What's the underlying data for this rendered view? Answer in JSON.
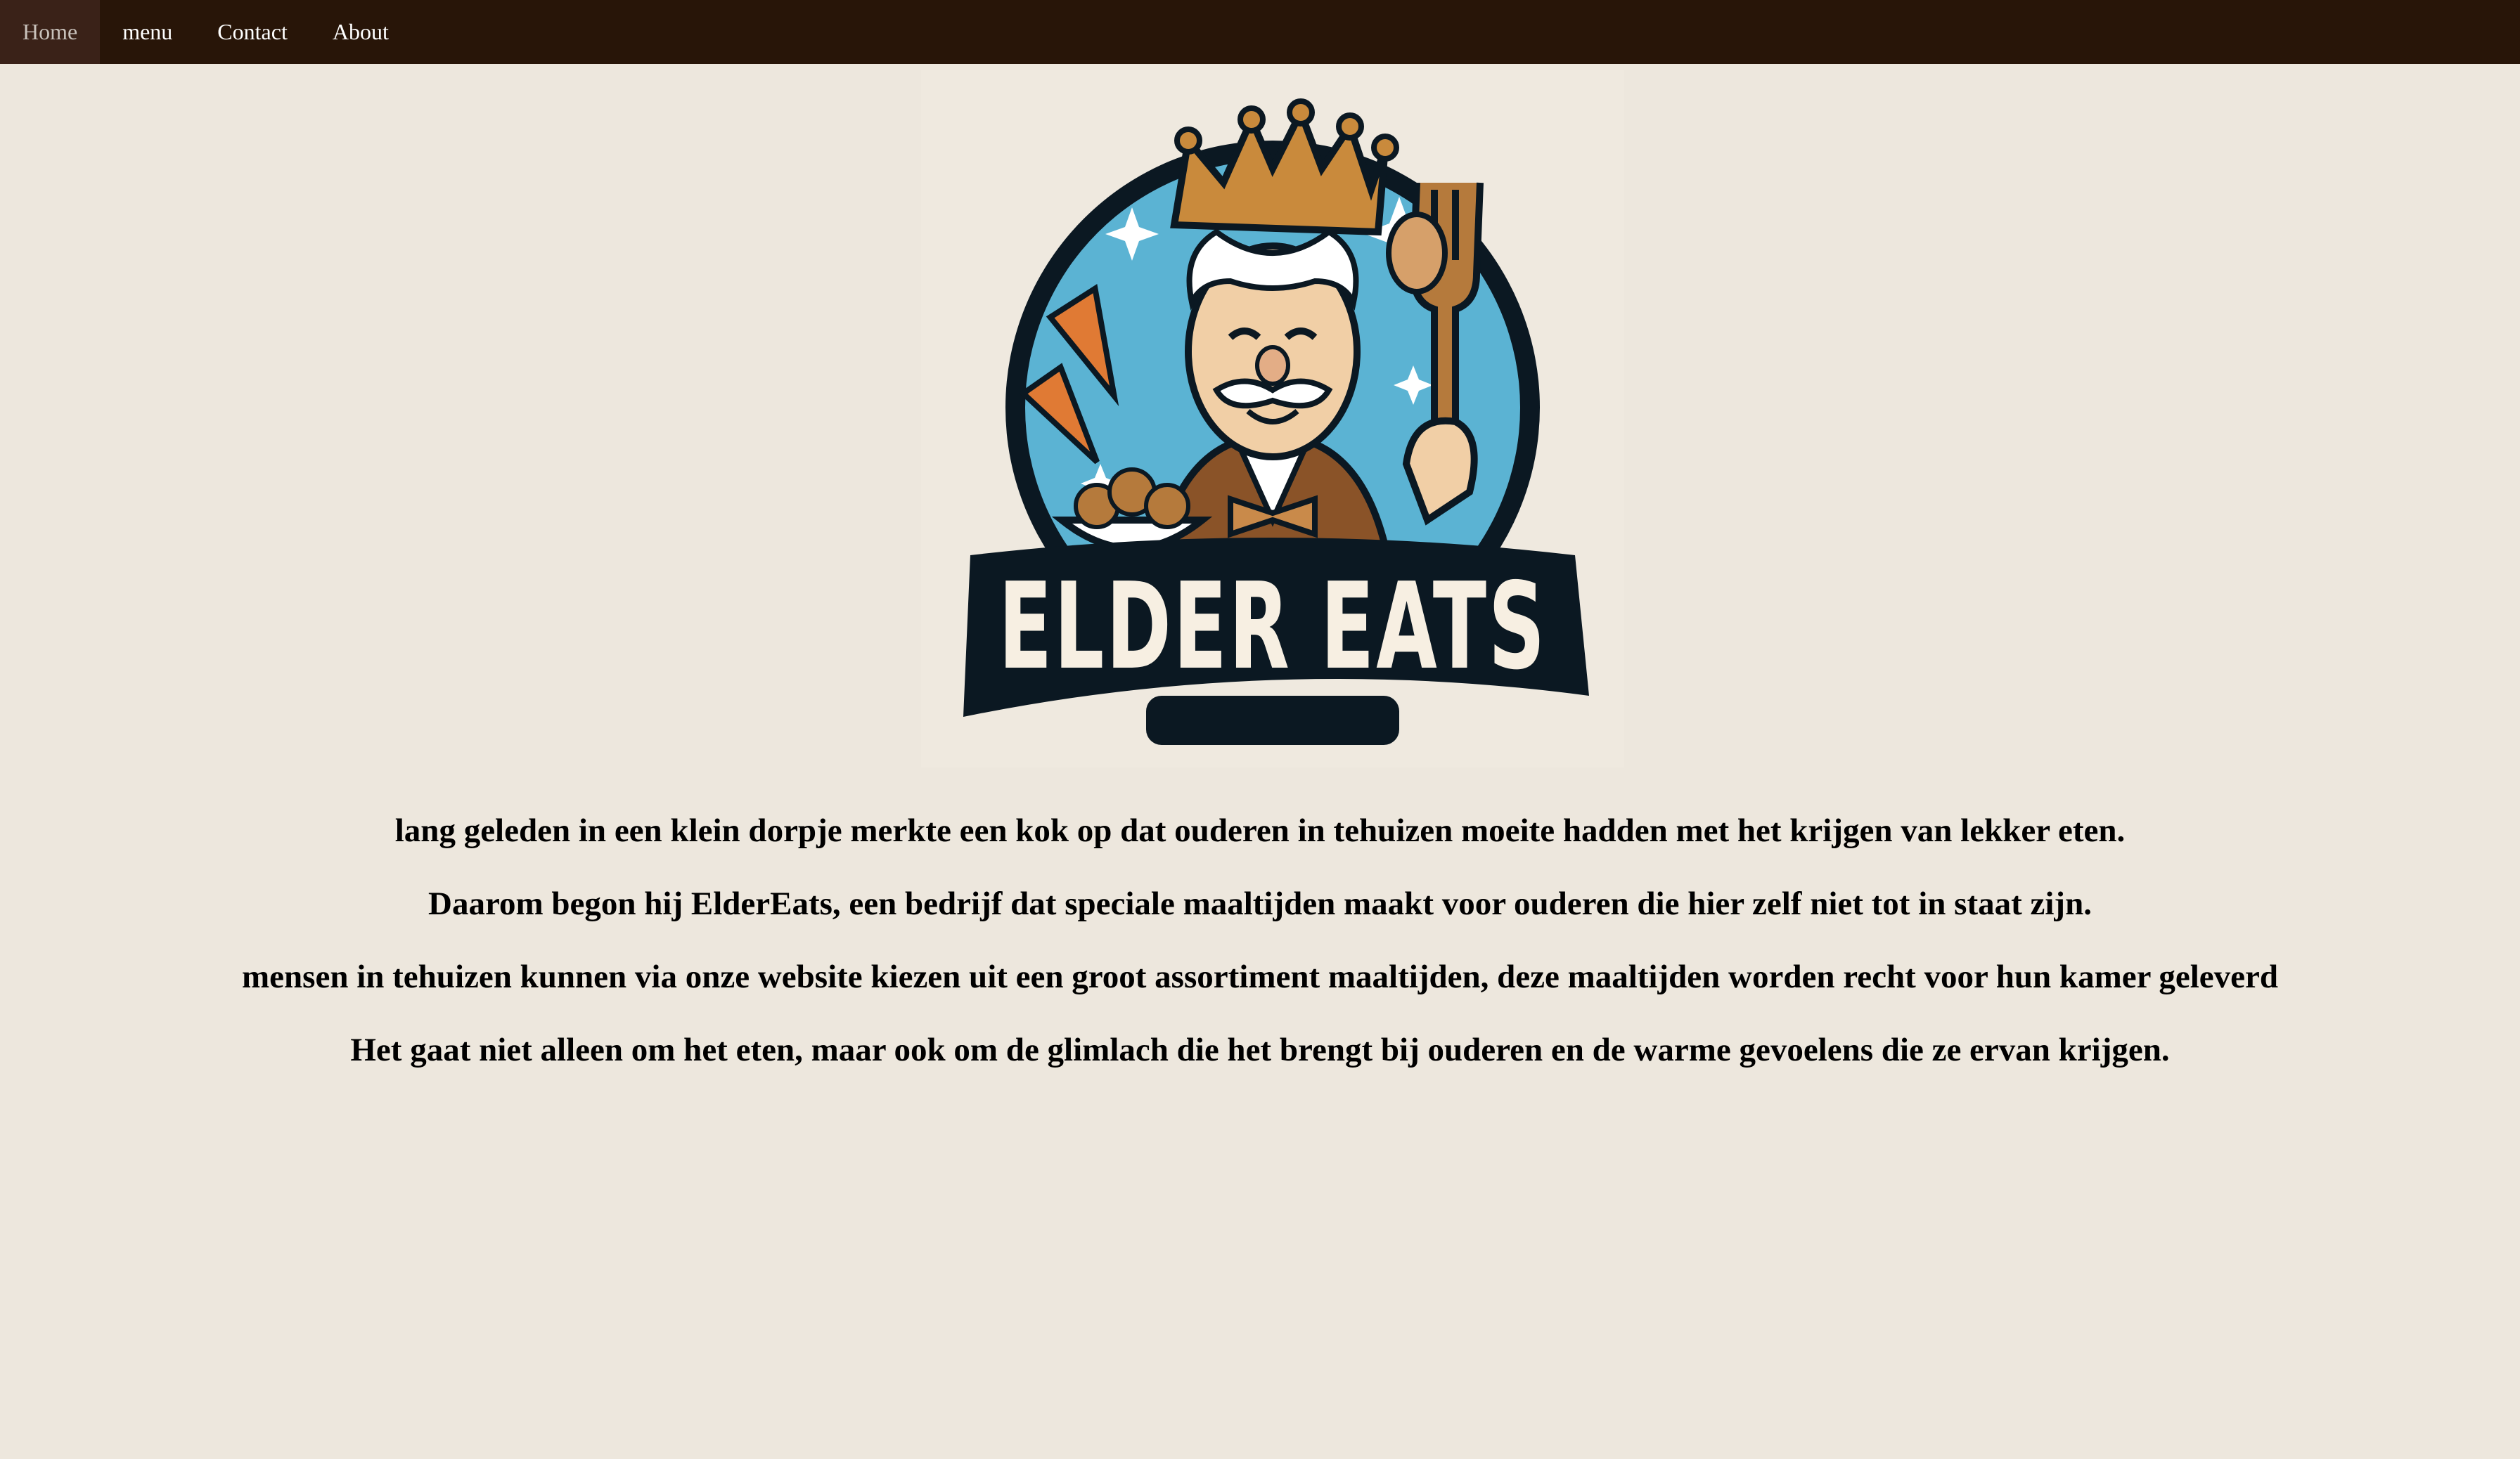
{
  "nav": {
    "items": [
      {
        "label": "Home",
        "active": true
      },
      {
        "label": "menu",
        "active": false
      },
      {
        "label": "Contact",
        "active": false
      },
      {
        "label": "About",
        "active": false
      }
    ]
  },
  "logo": {
    "text": "ELDER EATS",
    "icon": "chef-king-logo"
  },
  "story": {
    "paragraphs": [
      "lang geleden in een klein dorpje merkte een kok op dat ouderen in tehuizen moeite hadden met het krijgen van lekker eten.",
      "Daarom begon hij ElderEats, een bedrijf dat speciale maaltijden maakt voor ouderen die hier zelf niet tot in staat zijn.",
      "mensen in tehuizen kunnen via onze website kiezen uit een groot assortiment maaltijden, deze maaltijden worden recht voor hun kamer geleverd",
      "Het gaat niet alleen om het eten, maar ook om de glimlach die het brengt bij ouderen en de warme gevoelens die ze ervan krijgen."
    ]
  },
  "colors": {
    "nav_background": "#281508",
    "page_background": "#ede7dd",
    "logo_blue": "#5bb3d3",
    "logo_dark": "#0b1822",
    "logo_brown": "#b57a3c"
  }
}
